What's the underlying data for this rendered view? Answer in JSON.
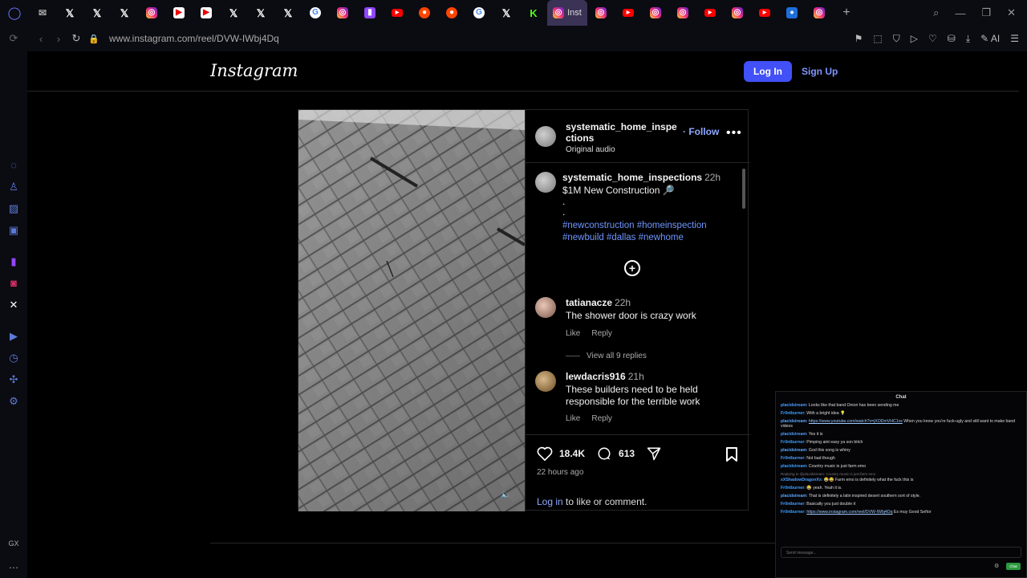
{
  "browser": {
    "url": "www.instagram.com/reel/DVW-IWbj4Dq",
    "active_tab_title": "Inst",
    "tabs": [
      "outlook-icon",
      "x-icon",
      "x-icon",
      "x-icon",
      "instagram-icon",
      "playlist-icon",
      "playlist-icon",
      "x-icon",
      "x-icon",
      "x-icon",
      "google-icon",
      "instagram-icon",
      "twitch-icon",
      "youtube-icon",
      "reddit-icon",
      "reddit-icon",
      "google-icon",
      "x-icon",
      "kick-icon",
      "instagram-icon-active",
      "instagram-icon",
      "youtube-icon",
      "instagram-icon",
      "instagram-icon",
      "youtube-icon",
      "instagram-icon",
      "youtube-icon",
      "app-icon",
      "instagram-icon"
    ],
    "ai_label": "AI",
    "accent": "#4150f7"
  },
  "instagram": {
    "logo": "Instagram",
    "login_label": "Log In",
    "signup_label": "Sign Up"
  },
  "post": {
    "author": "systematic_home_inspections",
    "audio": "Original audio",
    "follow_label": "Follow",
    "caption": {
      "user": "systematic_home_inspections",
      "time": "22h",
      "line1": "$1M New Construction 🔎",
      "dot1": ".",
      "dot2": ".",
      "hashtags": "#newconstruction #homeinspection #newbuild #dallas #newhome"
    },
    "comments": [
      {
        "user": "tatianacze",
        "time": "22h",
        "text": "The shower door is crazy work",
        "like": "Like",
        "reply": "Reply",
        "view_replies": "View all 9 replies"
      },
      {
        "user": "lewdacris916",
        "time": "21h",
        "text": "These builders need to be held responsible for the terrible work",
        "like": "Like",
        "reply": "Reply"
      }
    ],
    "likes": "18.4K",
    "comment_count": "613",
    "time_ago": "22 hours ago",
    "login_link": "Log in",
    "login_suffix": " to like or comment."
  },
  "chat": {
    "title": "Chat",
    "messages": [
      {
        "user": "placidstream",
        "text": " Looks like that band Onion has been sending me"
      },
      {
        "user": "Fr0ntburner",
        "text": " With a bright idea 💡"
      },
      {
        "user": "placidstream",
        "text": " ",
        "link": "https://www.youtube.com/watch?v=jXODmVHC1vs",
        "tail": " When you know you're fuck-ugly and still want to make band videos"
      },
      {
        "user": "placidstream",
        "text": " Yes it is"
      },
      {
        "user": "Fr0ntburner",
        "text": " Pimping aint easy ya son bitch"
      },
      {
        "user": "placidstream",
        "text": " God this song is whiny"
      },
      {
        "user": "Fr0ntburner",
        "text": " Not bad though"
      },
      {
        "user": "placidstream",
        "text": " Country music is just farm emo"
      },
      {
        "reply_note": "Replying to @placidstream: Country music is just farm emo"
      },
      {
        "user": "xXShadowDragonXx",
        "text": " 😂😂 Farm emo is definitely what the fuck this is"
      },
      {
        "user": "Fr0ntburner",
        "text": " 😂 yeah. Yeah it is."
      },
      {
        "user": "placidstream",
        "text": " That is definitely a latin inspired desert southern sort of style."
      },
      {
        "user": "Fr0ntburner",
        "text": " Basically you just double it"
      },
      {
        "user": "Fr0ntburner",
        "text": " ",
        "link": "https://www.instagram.com/reel/DVW-IWbj4Dq",
        "tail": " Es muy Good Señor"
      }
    ],
    "input_placeholder": "Send message...",
    "send_label": "Chat"
  }
}
